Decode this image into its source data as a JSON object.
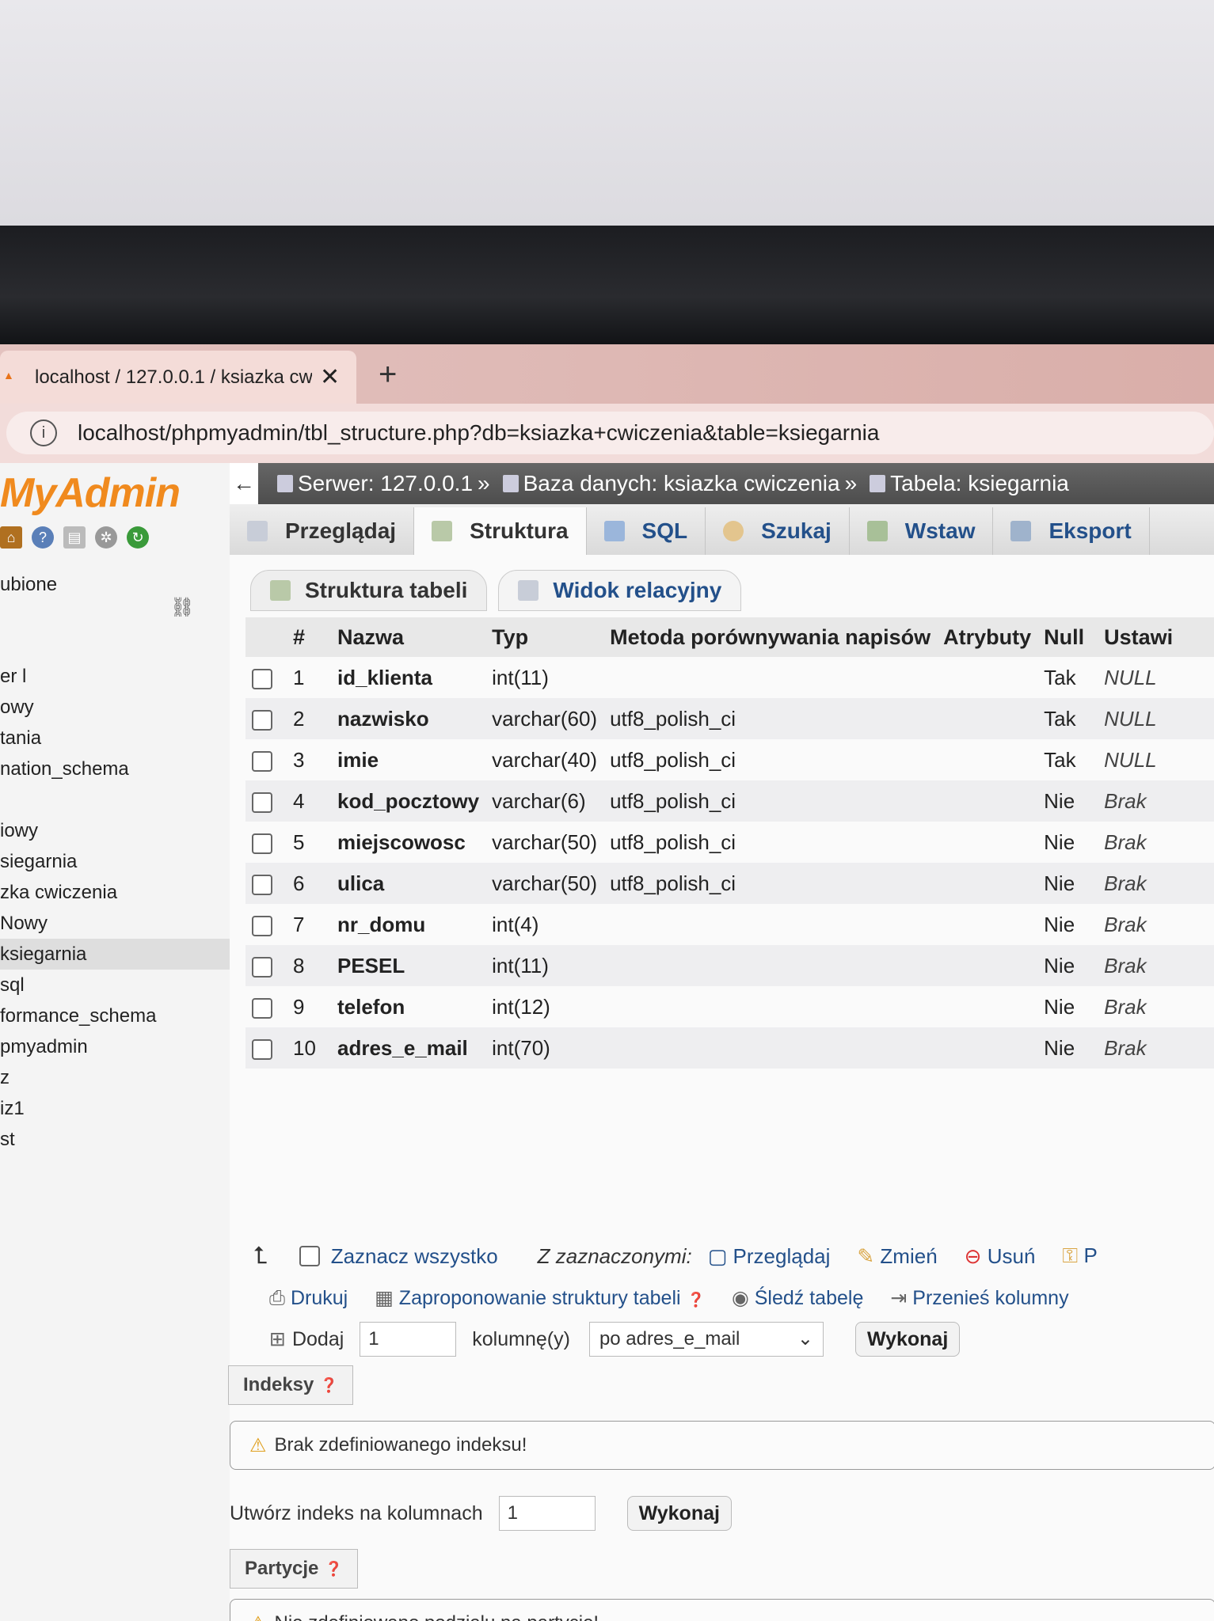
{
  "browser": {
    "tab_title": "localhost / 127.0.0.1 / ksiazka cw",
    "close_glyph": "✕",
    "new_tab_glyph": "+",
    "url": "localhost/phpmyadmin/tbl_structure.php?db=ksiazka+cwiczenia&table=ksiegarnia"
  },
  "nav": {
    "logo": "MyAdmin",
    "favorites_label": "ubione",
    "databases": [
      "er l",
      "owy",
      "tania",
      "nation_schema",
      "",
      "iowy",
      "siegarnia",
      "zka cwiczenia",
      "Nowy",
      "ksiegarnia",
      "sql",
      "formance_schema",
      "pmyadmin",
      "z",
      "iz1",
      "st"
    ]
  },
  "breadcrumb": {
    "back": "←",
    "server": "Serwer: 127.0.0.1",
    "sep": "»",
    "database": "Baza danych: ksiazka cwiczenia",
    "table": "Tabela: ksiegarnia"
  },
  "tabs": [
    "Przeglądaj",
    "Struktura",
    "SQL",
    "Szukaj",
    "Wstaw",
    "Eksport"
  ],
  "subtabs": [
    "Struktura tabeli",
    "Widok relacyjny"
  ],
  "columns_header": [
    "#",
    "Nazwa",
    "Typ",
    "Metoda porównywania napisów",
    "Atrybuty",
    "Null",
    "Ustawi"
  ],
  "rows": [
    {
      "n": "1",
      "name": "id_klienta",
      "type": "int(11)",
      "collation": "",
      "attr": "",
      "null": "Tak",
      "def": "NULL"
    },
    {
      "n": "2",
      "name": "nazwisko",
      "type": "varchar(60)",
      "collation": "utf8_polish_ci",
      "attr": "",
      "null": "Tak",
      "def": "NULL"
    },
    {
      "n": "3",
      "name": "imie",
      "type": "varchar(40)",
      "collation": "utf8_polish_ci",
      "attr": "",
      "null": "Tak",
      "def": "NULL"
    },
    {
      "n": "4",
      "name": "kod_pocztowy",
      "type": "varchar(6)",
      "collation": "utf8_polish_ci",
      "attr": "",
      "null": "Nie",
      "def": "Brak"
    },
    {
      "n": "5",
      "name": "miejscowosc",
      "type": "varchar(50)",
      "collation": "utf8_polish_ci",
      "attr": "",
      "null": "Nie",
      "def": "Brak"
    },
    {
      "n": "6",
      "name": "ulica",
      "type": "varchar(50)",
      "collation": "utf8_polish_ci",
      "attr": "",
      "null": "Nie",
      "def": "Brak"
    },
    {
      "n": "7",
      "name": "nr_domu",
      "type": "int(4)",
      "collation": "",
      "attr": "",
      "null": "Nie",
      "def": "Brak"
    },
    {
      "n": "8",
      "name": "PESEL",
      "type": "int(11)",
      "collation": "",
      "attr": "",
      "null": "Nie",
      "def": "Brak"
    },
    {
      "n": "9",
      "name": "telefon",
      "type": "int(12)",
      "collation": "",
      "attr": "",
      "null": "Nie",
      "def": "Brak"
    },
    {
      "n": "10",
      "name": "adres_e_mail",
      "type": "int(70)",
      "collation": "",
      "attr": "",
      "null": "Nie",
      "def": "Brak"
    }
  ],
  "bulk": {
    "select_all": "Zaznacz wszystko",
    "with_selected": "Z zaznaczonymi:",
    "browse": "Przeglądaj",
    "change": "Zmień",
    "delete": "Usuń",
    "more": "P"
  },
  "tools": {
    "print": "Drukuj",
    "propose": "Zaproponowanie struktury tabeli",
    "track": "Śledź tabelę",
    "move": "Przenieś kolumny"
  },
  "add": {
    "label": "Dodaj",
    "count": "1",
    "unit": "kolumnę(y)",
    "position": "po adres_e_mail",
    "go": "Wykonaj"
  },
  "indexes": {
    "legend": "Indeksy",
    "notice": "Brak zdefiniowanego indeksu!",
    "create_label": "Utwórz indeks na kolumnach",
    "create_count": "1",
    "go": "Wykonaj"
  },
  "partitions": {
    "legend": "Partycje",
    "notice": "Nie zdefiniowano podziału na partycje!"
  }
}
